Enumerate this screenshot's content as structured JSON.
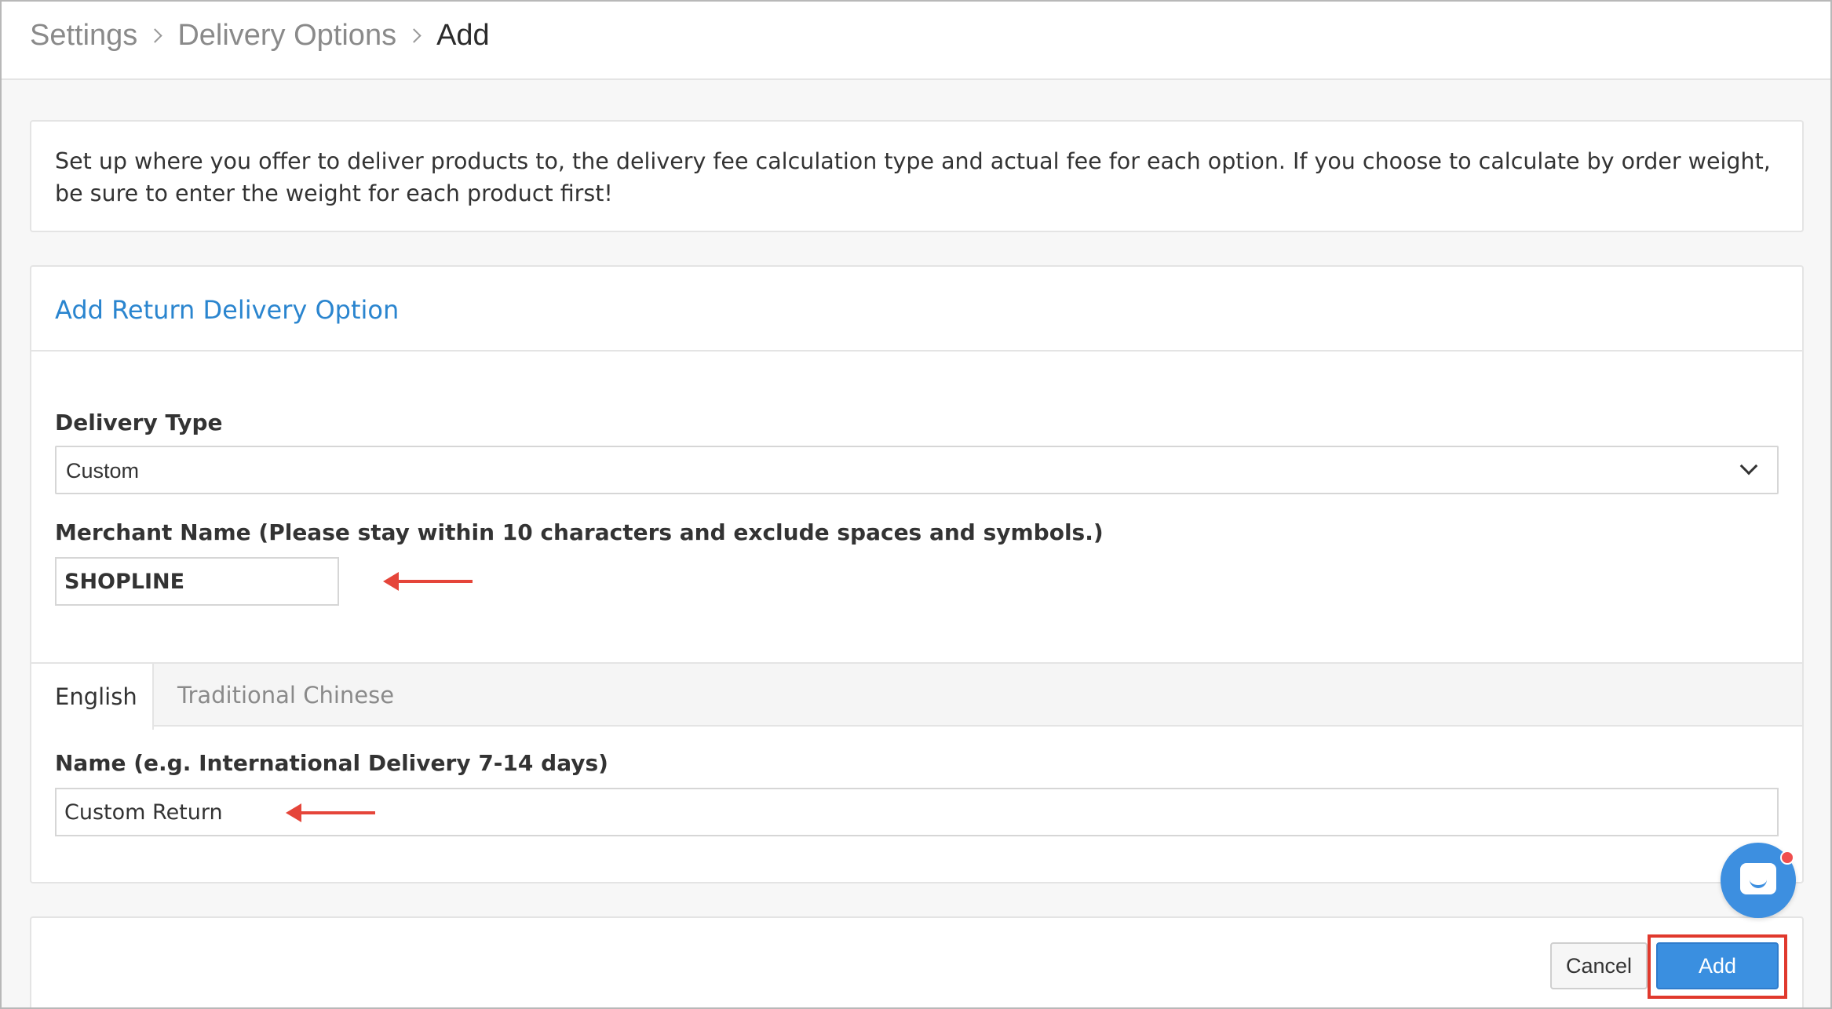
{
  "breadcrumb": {
    "items": [
      "Settings",
      "Delivery Options"
    ],
    "current": "Add"
  },
  "intro": {
    "text": "Set up where you offer to deliver products to, the delivery fee calculation type and actual fee for each option. If you choose to calculate by order weight, be sure to enter the weight for each product first!"
  },
  "form": {
    "title": "Add Return Delivery Option",
    "delivery_type_label": "Delivery Type",
    "delivery_type_value": "Custom",
    "merchant_label": "Merchant Name (Please stay within 10 characters and exclude spaces and symbols.)",
    "merchant_value": "SHOPLINE",
    "tabs": [
      "English",
      "Traditional Chinese"
    ],
    "active_tab": "English",
    "name_label": "Name (e.g. International Delivery 7-14 days)",
    "name_value": "Custom Return"
  },
  "actions": {
    "cancel_label": "Cancel",
    "add_label": "Add"
  },
  "colors": {
    "accent": "#2a85cf",
    "primary_button": "#3a8fe0",
    "annotation_red": "#e5453a"
  },
  "icons": [
    "chevron-right-icon",
    "chevron-down-icon",
    "chat-icon",
    "arrow-left-icon"
  ]
}
